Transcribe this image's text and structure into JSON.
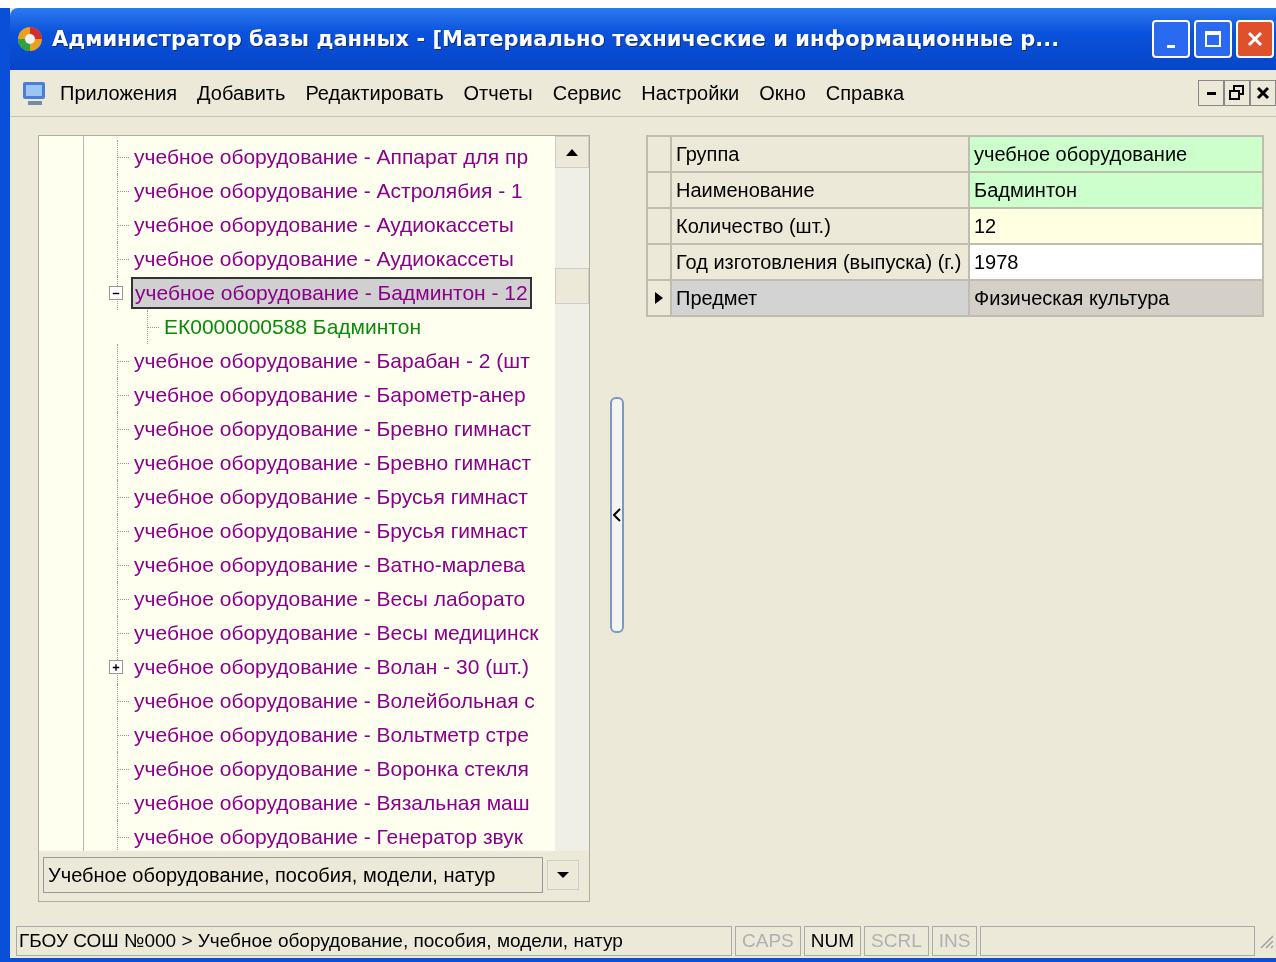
{
  "window": {
    "title": "Администратор базы данных - [Материально технические и информационные р..."
  },
  "menu": [
    "Приложения",
    "Добавить",
    "Редактировать",
    "Отчеты",
    "Сервис",
    "Настройки",
    "Окно",
    "Справка"
  ],
  "tree": {
    "items": [
      {
        "label": "учебное оборудование - Аппарат для пр",
        "kind": "leaf",
        "selected": false
      },
      {
        "label": "учебное оборудование - Астролябия - 1",
        "kind": "leaf",
        "selected": false
      },
      {
        "label": "учебное оборудование - Аудиокассеты",
        "kind": "leaf",
        "selected": false
      },
      {
        "label": "учебное оборудование - Аудиокассеты",
        "kind": "leaf",
        "selected": false
      },
      {
        "label": "учебное оборудование - Бадминтон - 12",
        "kind": "group",
        "expanded": true,
        "selected": true,
        "children": [
          {
            "label": "ЕК0000000588 Бадминтон",
            "selected": false
          }
        ]
      },
      {
        "label": "учебное оборудование - Барабан - 2 (шт",
        "kind": "leaf",
        "selected": false
      },
      {
        "label": "учебное оборудование - Барометр-анер",
        "kind": "leaf",
        "selected": false
      },
      {
        "label": "учебное оборудование - Бревно гимнаст",
        "kind": "leaf",
        "selected": false
      },
      {
        "label": "учебное оборудование - Бревно гимнаст",
        "kind": "leaf",
        "selected": false
      },
      {
        "label": "учебное оборудование - Брусья гимнаст",
        "kind": "leaf",
        "selected": false
      },
      {
        "label": "учебное оборудование - Брусья гимнаст",
        "kind": "leaf",
        "selected": false
      },
      {
        "label": "учебное оборудование - Ватно-марлева",
        "kind": "leaf",
        "selected": false
      },
      {
        "label": "учебное оборудование - Весы лаборато",
        "kind": "leaf",
        "selected": false
      },
      {
        "label": "учебное оборудование - Весы медицинск",
        "kind": "leaf",
        "selected": false
      },
      {
        "label": "учебное оборудование - Волан - 30 (шт.)",
        "kind": "group",
        "expanded": false,
        "selected": false
      },
      {
        "label": "учебное оборудование - Волейбольная с",
        "kind": "leaf",
        "selected": false
      },
      {
        "label": "учебное оборудование - Вольтметр стре",
        "kind": "leaf",
        "selected": false
      },
      {
        "label": "учебное оборудование - Воронка стекля",
        "kind": "leaf",
        "selected": false
      },
      {
        "label": "учебное оборудование - Вязальная маш",
        "kind": "leaf",
        "selected": false
      },
      {
        "label": "учебное оборудование - Генератор звук",
        "kind": "leaf",
        "selected": false
      }
    ],
    "category": {
      "value": "Учебное оборудование, пособия, модели, натур"
    }
  },
  "properties": [
    {
      "label": "Группа",
      "value": "учебное оборудование",
      "color": "#ccffcc",
      "selected": false
    },
    {
      "label": "Наименование",
      "value": "Бадминтон",
      "color": "#ccffcc",
      "selected": false
    },
    {
      "label": "Количество (шт.)",
      "value": "12",
      "color": "#ffffe1",
      "selected": false
    },
    {
      "label": "Год изготовления (выпуска) (г.)",
      "value": "1978",
      "color": "#ffffff",
      "selected": false
    },
    {
      "label": "Предмет",
      "value": "Физическая культура",
      "color": "#d4d0c8",
      "selected": true
    }
  ],
  "status_bar": {
    "path": "ГБОУ СОШ №000 > Учебное оборудование, пособия, модели, натур",
    "indicators": [
      {
        "label": "CAPS",
        "on": false
      },
      {
        "label": "NUM",
        "on": true
      },
      {
        "label": "SCRL",
        "on": false
      },
      {
        "label": "INS",
        "on": false
      }
    ]
  }
}
